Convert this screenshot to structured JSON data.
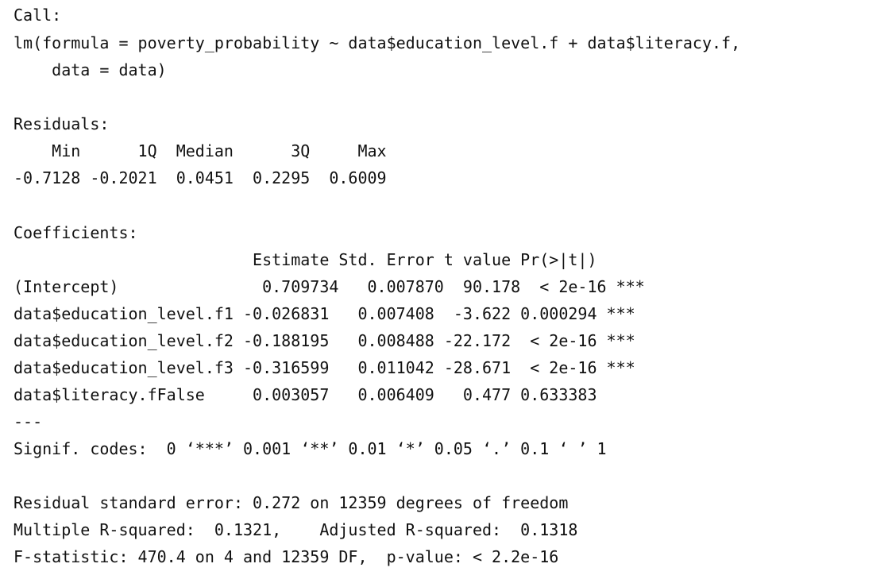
{
  "call": {
    "header": "Call:",
    "formula_line": "lm(formula = poverty_probability ~ data$education_level.f + data$literacy.f,",
    "data_line": "    data = data)"
  },
  "residuals": {
    "header": "Residuals:",
    "labels_line": "    Min      1Q  Median      3Q     Max ",
    "values_line": "-0.7128 -0.2021  0.0451  0.2295  0.6009 "
  },
  "coefficients": {
    "header": "Coefficients:",
    "column_header_line": "                         Estimate Std. Error t value Pr(>|t|)    ",
    "rows": [
      "(Intercept)               0.709734   0.007870  90.178  < 2e-16 ***",
      "data$education_level.f1 -0.026831   0.007408  -3.622 0.000294 ***",
      "data$education_level.f2 -0.188195   0.008488 -22.172  < 2e-16 ***",
      "data$education_level.f3 -0.316599   0.011042 -28.671  < 2e-16 ***",
      "data$literacy.fFalse     0.003057   0.006409   0.477 0.633383    "
    ],
    "separator": "---",
    "signif_codes": "Signif. codes:  0 ‘***’ 0.001 ‘**’ 0.01 ‘*’ 0.05 ‘.’ 0.1 ‘ ’ 1"
  },
  "summary": {
    "residual_se": "Residual standard error: 0.272 on 12359 degrees of freedom",
    "r_squared": "Multiple R-squared:  0.1321,\tAdjusted R-squared:  0.1318 ",
    "f_statistic": "F-statistic: 470.4 on 4 and 12359 DF,  p-value: < 2.2e-16"
  }
}
